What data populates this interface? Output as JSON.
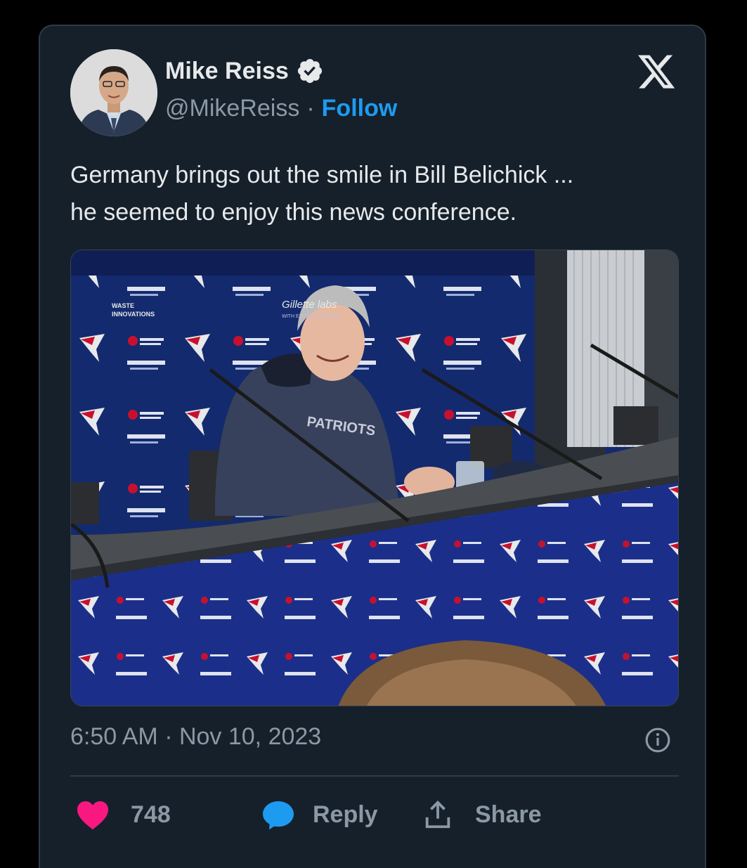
{
  "author": {
    "name": "Mike Reiss",
    "handle": "@MikeReiss",
    "separator": "·",
    "follow_label": "Follow"
  },
  "tweet": {
    "lines": [
      "Germany brings out the smile in Bill Belichick ...",
      "he seemed to enjoy this news conference."
    ]
  },
  "media": {
    "sponsor_lines": [
      "Gillette labs",
      "WITH EXFOLIATING BAR",
      "WASTE",
      "INNOVATIONS"
    ],
    "hoodie_text": "PATRIOTS"
  },
  "meta": {
    "timestamp": "6:50 AM · Nov 10, 2023"
  },
  "actions": {
    "like_count": "748",
    "reply_label": "Reply",
    "share_label": "Share"
  },
  "colors": {
    "background": "#15202b",
    "link": "#1d9bf0",
    "muted": "#8b98a5",
    "like": "#f91880",
    "reply": "#1d9bf0"
  },
  "icons": [
    "verified-badge-icon",
    "x-logo-icon",
    "info-icon",
    "heart-icon",
    "reply-bubble-icon",
    "share-icon"
  ]
}
